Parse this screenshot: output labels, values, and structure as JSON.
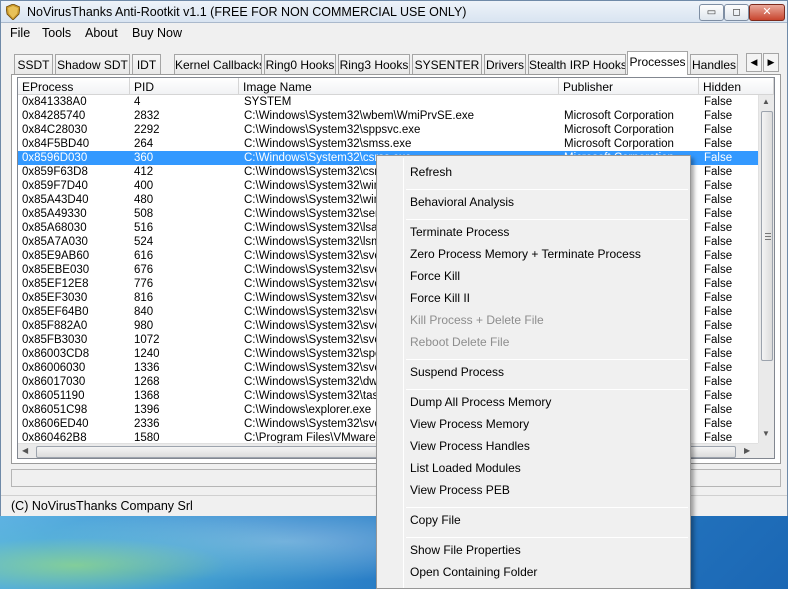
{
  "window": {
    "title": "NoVirusThanks Anti-Rootkit v1.1 (FREE FOR NON COMMERCIAL USE ONLY)",
    "controls": {
      "minimize": "▭",
      "maximize": "◻",
      "close": "✕"
    }
  },
  "menu": [
    "File",
    "Tools",
    "About",
    "Buy Now"
  ],
  "tabs": [
    "SSDT",
    "Shadow SDT",
    "IDT",
    "Kernel Callbacks",
    "Ring0 Hooks",
    "Ring3 Hooks",
    "SYSENTER",
    "Drivers",
    "Stealth IRP Hooks",
    "Processes",
    "Handles"
  ],
  "active_tab": "Processes",
  "tab_scroll": {
    "left": "◀",
    "right": "▶"
  },
  "table": {
    "columns": [
      "EProcess",
      "PID",
      "Image Name",
      "Publisher",
      "Hidden"
    ],
    "rows": [
      [
        "0x841338A0",
        "4",
        "SYSTEM",
        "",
        "False"
      ],
      [
        "0x84285740",
        "2832",
        "C:\\Windows\\System32\\wbem\\WmiPrvSE.exe",
        "Microsoft Corporation",
        "False"
      ],
      [
        "0x84C28030",
        "2292",
        "C:\\Windows\\System32\\sppsvc.exe",
        "Microsoft Corporation",
        "False"
      ],
      [
        "0x84F5BD40",
        "264",
        "C:\\Windows\\System32\\smss.exe",
        "Microsoft Corporation",
        "False"
      ],
      [
        "0x8596D030",
        "360",
        "C:\\Windows\\System32\\csrss.exe",
        "Microsoft Corporation",
        "False"
      ],
      [
        "0x859F63D8",
        "412",
        "C:\\Windows\\System32\\csrs",
        "",
        "False"
      ],
      [
        "0x859F7D40",
        "400",
        "C:\\Windows\\System32\\wini",
        "",
        "False"
      ],
      [
        "0x85A43D40",
        "480",
        "C:\\Windows\\System32\\winl",
        "",
        "False"
      ],
      [
        "0x85A49330",
        "508",
        "C:\\Windows\\System32\\serv",
        "",
        "False"
      ],
      [
        "0x85A68030",
        "516",
        "C:\\Windows\\System32\\lsas",
        "",
        "False"
      ],
      [
        "0x85A7A030",
        "524",
        "C:\\Windows\\System32\\lsm.",
        "",
        "False"
      ],
      [
        "0x85E9AB60",
        "616",
        "C:\\Windows\\System32\\svc",
        "",
        "False"
      ],
      [
        "0x85EBE030",
        "676",
        "C:\\Windows\\System32\\svc",
        "",
        "False"
      ],
      [
        "0x85EF12E8",
        "776",
        "C:\\Windows\\System32\\svc",
        "",
        "False"
      ],
      [
        "0x85EF3030",
        "816",
        "C:\\Windows\\System32\\svc",
        "",
        "False"
      ],
      [
        "0x85EF64B0",
        "840",
        "C:\\Windows\\System32\\svc",
        "",
        "False"
      ],
      [
        "0x85F882A0",
        "980",
        "C:\\Windows\\System32\\svc",
        "",
        "False"
      ],
      [
        "0x85FB3030",
        "1072",
        "C:\\Windows\\System32\\svc",
        "",
        "False"
      ],
      [
        "0x86003CD8",
        "1240",
        "C:\\Windows\\System32\\spo",
        "",
        "False"
      ],
      [
        "0x86006030",
        "1336",
        "C:\\Windows\\System32\\svc",
        "",
        "False"
      ],
      [
        "0x86017030",
        "1268",
        "C:\\Windows\\System32\\dwr",
        "",
        "False"
      ],
      [
        "0x86051190",
        "1368",
        "C:\\Windows\\System32\\task",
        "",
        "False"
      ],
      [
        "0x86051C98",
        "1396",
        "C:\\Windows\\explorer.exe",
        "",
        "False"
      ],
      [
        "0x8606ED40",
        "2336",
        "C:\\Windows\\System32\\svc",
        "",
        "False"
      ],
      [
        "0x860462B8",
        "1580",
        "C:\\Program Files\\VMware\\V",
        "",
        "False"
      ]
    ],
    "selected_row": 4
  },
  "statusbar": {
    "text": "(C) NoVirusThanks Company Srl"
  },
  "context_menu": {
    "groups": [
      [
        {
          "label": "Refresh",
          "enabled": true
        }
      ],
      [
        {
          "label": "Behavioral Analysis",
          "enabled": true
        }
      ],
      [
        {
          "label": "Terminate Process",
          "enabled": true
        },
        {
          "label": "Zero Process Memory + Terminate Process",
          "enabled": true
        },
        {
          "label": "Force Kill",
          "enabled": true
        },
        {
          "label": "Force Kill II",
          "enabled": true
        },
        {
          "label": "Kill Process + Delete File",
          "enabled": false
        },
        {
          "label": "Reboot Delete File",
          "enabled": false
        }
      ],
      [
        {
          "label": "Suspend Process",
          "enabled": true
        }
      ],
      [
        {
          "label": "Dump All Process Memory",
          "enabled": true
        },
        {
          "label": "View Process Memory",
          "enabled": true
        },
        {
          "label": "View Process Handles",
          "enabled": true
        },
        {
          "label": "List Loaded Modules",
          "enabled": true
        },
        {
          "label": "View Process PEB",
          "enabled": true
        }
      ],
      [
        {
          "label": "Copy File",
          "enabled": true
        }
      ],
      [
        {
          "label": "Show File Properties",
          "enabled": true
        },
        {
          "label": "Open Containing Folder",
          "enabled": true
        }
      ]
    ]
  },
  "colors": {
    "selection": "#3399ff",
    "window_bg": "#f0f0f0",
    "disabled_text": "#8d8d8d"
  },
  "icons": [
    "shield-app-icon",
    "scroll-up-icon",
    "scroll-down-icon",
    "scroll-left-icon",
    "scroll-right-icon"
  ]
}
